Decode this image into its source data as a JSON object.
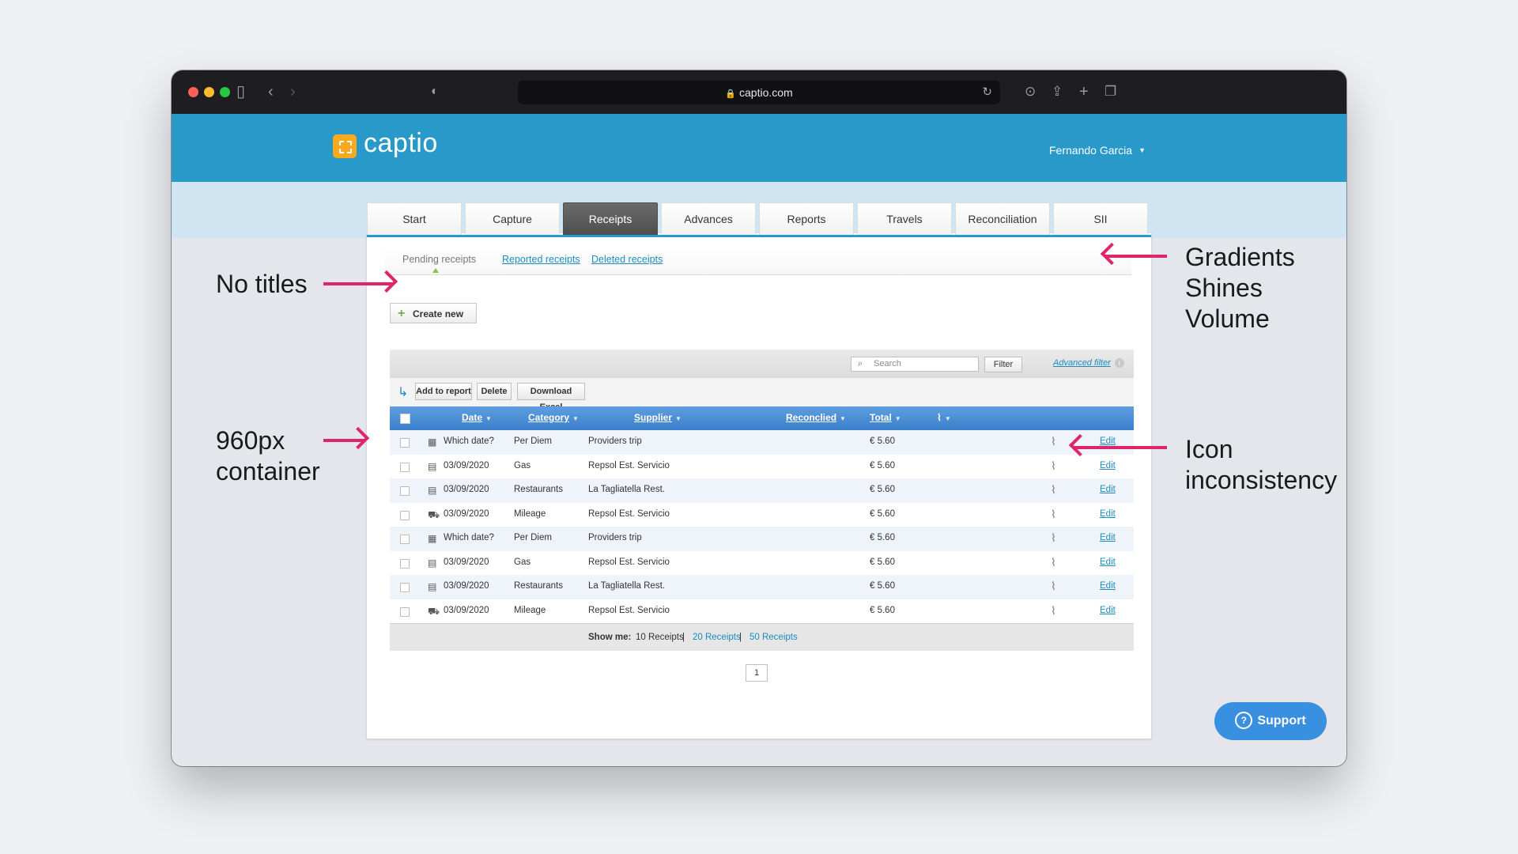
{
  "browser": {
    "url": "captio.com",
    "icons": [
      "sidebar-icon",
      "back-icon",
      "forward-icon",
      "shield-icon",
      "reload-icon",
      "download-icon",
      "share-icon",
      "new-tab-icon",
      "tabs-overview-icon"
    ]
  },
  "app": {
    "logo_text": "captio",
    "user_name": "Fernando Garcia",
    "colors": {
      "header": "#2899c8",
      "accent_logo": "#f9a91e",
      "active_tab": "#555555",
      "table_head": "#4a8fd6",
      "link": "#1a8cc0",
      "annotation": "#e0246a"
    }
  },
  "tabs": [
    {
      "label": "Start"
    },
    {
      "label": "Capture"
    },
    {
      "label": "Receipts",
      "active": true
    },
    {
      "label": "Advances"
    },
    {
      "label": "Reports"
    },
    {
      "label": "Travels"
    },
    {
      "label": "Reconciliation"
    },
    {
      "label": "SII"
    }
  ],
  "subtabs": {
    "pending": "Pending receipts",
    "reported": "Reported receipts",
    "deleted": "Deleted receipts"
  },
  "toolbar": {
    "create_new": "Create new",
    "search_placeholder": "Search",
    "filter": "Filter",
    "advanced_filter": "Advanced filter",
    "add_to_report": "Add to report",
    "delete": "Delete",
    "download_excel": "Download Excel"
  },
  "table": {
    "columns": {
      "date": "Date",
      "category": "Category",
      "supplier": "Supplier",
      "reconciled": "Reconclied",
      "total": "Total"
    },
    "edit_label": "Edit",
    "rows": [
      {
        "icon": "calendar-icon",
        "date": "Which date?",
        "category": "Per Diem",
        "supplier": "Providers trip",
        "total": "€ 5.60"
      },
      {
        "icon": "receipt-icon",
        "date": "03/09/2020",
        "category": "Gas",
        "supplier": "Repsol Est. Servicio",
        "total": "€ 5.60"
      },
      {
        "icon": "receipt-icon",
        "date": "03/09/2020",
        "category": "Restaurants",
        "supplier": "La Tagliatella Rest.",
        "total": "€ 5.60"
      },
      {
        "icon": "car-icon",
        "date": "03/09/2020",
        "category": "Mileage",
        "supplier": "Repsol Est. Servicio",
        "total": "€ 5.60"
      },
      {
        "icon": "calendar-icon",
        "date": "Which date?",
        "category": "Per Diem",
        "supplier": "Providers trip",
        "total": "€ 5.60"
      },
      {
        "icon": "receipt-icon",
        "date": "03/09/2020",
        "category": "Gas",
        "supplier": "Repsol Est. Servicio",
        "total": "€ 5.60"
      },
      {
        "icon": "receipt-icon",
        "date": "03/09/2020",
        "category": "Restaurants",
        "supplier": "La Tagliatella Rest.",
        "total": "€ 5.60"
      },
      {
        "icon": "car-icon",
        "date": "03/09/2020",
        "category": "Mileage",
        "supplier": "Repsol Est. Servicio",
        "total": "€ 5.60"
      }
    ]
  },
  "footer": {
    "show_me": "Show me:",
    "opt10": "10 Receipts",
    "opt20": "20 Receipts",
    "opt50": "50 Receipts",
    "sep": "|",
    "page": "1"
  },
  "support": "Support",
  "annotations": {
    "no_titles": "No titles",
    "container_line1": "960px",
    "container_line2": "container",
    "gradients_line1": "Gradients",
    "gradients_line2": "Shines",
    "gradients_line3": "Volume",
    "icon_line1": "Icon",
    "icon_line2": "inconsistency"
  }
}
